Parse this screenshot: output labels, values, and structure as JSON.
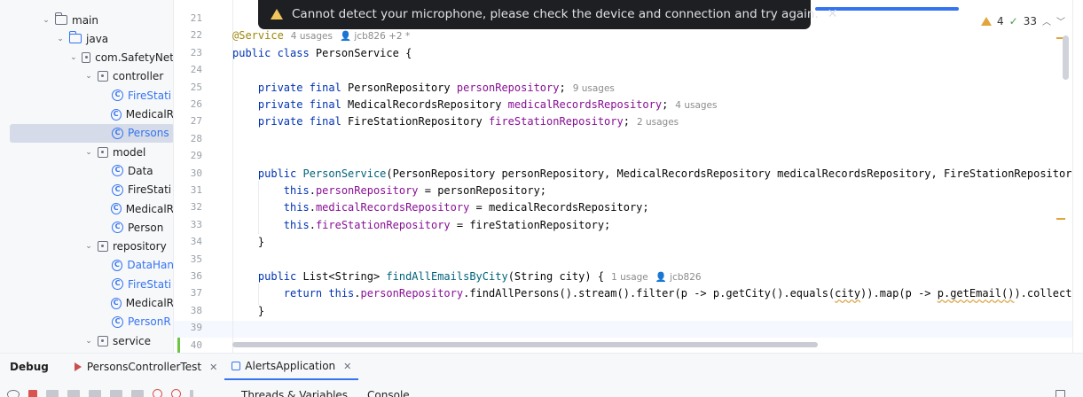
{
  "notification": {
    "text": "Cannot detect your microphone, please check the device and connection and try again.",
    "close": "✕"
  },
  "project_tree": [
    {
      "label": "main",
      "depth": 3,
      "kind": "folder",
      "expanded": true
    },
    {
      "label": "java",
      "depth": 4,
      "kind": "src-folder",
      "expanded": true
    },
    {
      "label": "com.SafetyNet",
      "depth": 5,
      "kind": "package",
      "expanded": true
    },
    {
      "label": "controller",
      "depth": 6,
      "kind": "package",
      "expanded": true
    },
    {
      "label": "FireStati",
      "depth": 7,
      "kind": "class",
      "vcs": true
    },
    {
      "label": "MedicalR",
      "depth": 7,
      "kind": "class"
    },
    {
      "label": "Persons",
      "depth": 7,
      "kind": "class",
      "vcs": true,
      "selected": true
    },
    {
      "label": "model",
      "depth": 6,
      "kind": "package",
      "expanded": true
    },
    {
      "label": "Data",
      "depth": 7,
      "kind": "class"
    },
    {
      "label": "FireStati",
      "depth": 7,
      "kind": "class"
    },
    {
      "label": "MedicalR",
      "depth": 7,
      "kind": "class"
    },
    {
      "label": "Person",
      "depth": 7,
      "kind": "class"
    },
    {
      "label": "repository",
      "depth": 6,
      "kind": "package",
      "expanded": true
    },
    {
      "label": "DataHan",
      "depth": 7,
      "kind": "class",
      "vcs": true
    },
    {
      "label": "FireStati",
      "depth": 7,
      "kind": "class",
      "vcs": true
    },
    {
      "label": "MedicalR",
      "depth": 7,
      "kind": "class"
    },
    {
      "label": "PersonR",
      "depth": 7,
      "kind": "class",
      "vcs": true
    },
    {
      "label": "service",
      "depth": 6,
      "kind": "package",
      "expanded": true
    }
  ],
  "editor": {
    "inspections": {
      "warnings": "4",
      "ok": "33"
    },
    "lines": [
      {
        "n": "21",
        "tokens": []
      },
      {
        "n": "22",
        "tokens": [
          {
            "t": "@Service",
            "c": "ann"
          },
          {
            "t": "4 usages",
            "c": "hint"
          },
          {
            "t": "👤 jcb826 +2 *",
            "c": "hint"
          }
        ]
      },
      {
        "n": "23",
        "tokens": [
          {
            "t": "public class ",
            "c": "kw"
          },
          {
            "t": "PersonService {",
            "c": ""
          }
        ]
      },
      {
        "n": "24",
        "tokens": []
      },
      {
        "n": "25",
        "tokens": [
          {
            "t": "    private final ",
            "c": "kw"
          },
          {
            "t": "PersonRepository ",
            "c": ""
          },
          {
            "t": "personRepository",
            "c": "fld"
          },
          {
            "t": ";",
            "c": ""
          },
          {
            "t": "9 usages",
            "c": "hint"
          }
        ]
      },
      {
        "n": "26",
        "tokens": [
          {
            "t": "    private final ",
            "c": "kw"
          },
          {
            "t": "MedicalRecordsRepository ",
            "c": ""
          },
          {
            "t": "medicalRecordsRepository",
            "c": "fld"
          },
          {
            "t": ";",
            "c": ""
          },
          {
            "t": "4 usages",
            "c": "hint"
          }
        ]
      },
      {
        "n": "27",
        "tokens": [
          {
            "t": "    private final ",
            "c": "kw"
          },
          {
            "t": "FireStationRepository ",
            "c": ""
          },
          {
            "t": "fireStationRepository",
            "c": "fld"
          },
          {
            "t": ";",
            "c": ""
          },
          {
            "t": "2 usages",
            "c": "hint"
          }
        ]
      },
      {
        "n": "28",
        "tokens": []
      },
      {
        "n": "29",
        "tokens": []
      },
      {
        "n": "30",
        "tokens": [
          {
            "t": "    public ",
            "c": "kw"
          },
          {
            "t": "PersonService",
            "c": "mth"
          },
          {
            "t": "(PersonRepository personRepository, MedicalRecordsRepository medicalRecordsRepository, FireStationRepository",
            "c": ""
          }
        ]
      },
      {
        "n": "31",
        "tokens": [
          {
            "t": "        this",
            "c": "kw"
          },
          {
            "t": ".",
            "c": ""
          },
          {
            "t": "personRepository",
            "c": "fld"
          },
          {
            "t": " = personRepository;",
            "c": ""
          }
        ]
      },
      {
        "n": "32",
        "tokens": [
          {
            "t": "        this",
            "c": "kw"
          },
          {
            "t": ".",
            "c": ""
          },
          {
            "t": "medicalRecordsRepository",
            "c": "fld"
          },
          {
            "t": " = medicalRecordsRepository;",
            "c": ""
          }
        ]
      },
      {
        "n": "33",
        "tokens": [
          {
            "t": "        this",
            "c": "kw"
          },
          {
            "t": ".",
            "c": ""
          },
          {
            "t": "fireStationRepository",
            "c": "fld"
          },
          {
            "t": " = fireStationRepository;",
            "c": ""
          }
        ]
      },
      {
        "n": "34",
        "tokens": [
          {
            "t": "    }",
            "c": ""
          }
        ]
      },
      {
        "n": "35",
        "tokens": []
      },
      {
        "n": "36",
        "tokens": [
          {
            "t": "    public ",
            "c": "kw"
          },
          {
            "t": "List<String> ",
            "c": ""
          },
          {
            "t": "findAllEmailsByCity",
            "c": "mth"
          },
          {
            "t": "(String city) {",
            "c": ""
          },
          {
            "t": "1 usage",
            "c": "hint"
          },
          {
            "t": "👤 jcb826",
            "c": "hint"
          }
        ]
      },
      {
        "n": "37",
        "tokens": [
          {
            "t": "        return this",
            "c": "kw"
          },
          {
            "t": ".",
            "c": ""
          },
          {
            "t": "personRepository",
            "c": "fld"
          },
          {
            "t": ".findAllPersons().stream().filter(p -> p.getCity().equals(",
            "c": ""
          },
          {
            "t": "city",
            "c": "warn"
          },
          {
            "t": ")).map(p -> ",
            "c": ""
          },
          {
            "t": "p.getEmail()",
            "c": "warn"
          },
          {
            "t": ").collect(C",
            "c": ""
          }
        ]
      },
      {
        "n": "38",
        "tokens": [
          {
            "t": "    }",
            "c": ""
          }
        ]
      },
      {
        "n": "39",
        "tokens": []
      },
      {
        "n": "40",
        "tokens": []
      }
    ]
  },
  "bottom": {
    "title": "Debug",
    "tabs": [
      {
        "label": "PersonsControllerTest",
        "icon": "test-run-icon",
        "active": false
      },
      {
        "label": "AlertsApplication",
        "icon": "application-icon",
        "active": true
      }
    ],
    "subtabs": [
      "Threads & Variables",
      "Console"
    ]
  },
  "colors": {
    "accent": "#3574f0",
    "keyword": "#0033b3",
    "field": "#871094",
    "method": "#00627a",
    "annotation": "#9e880d",
    "warning": "#e2a53b"
  }
}
